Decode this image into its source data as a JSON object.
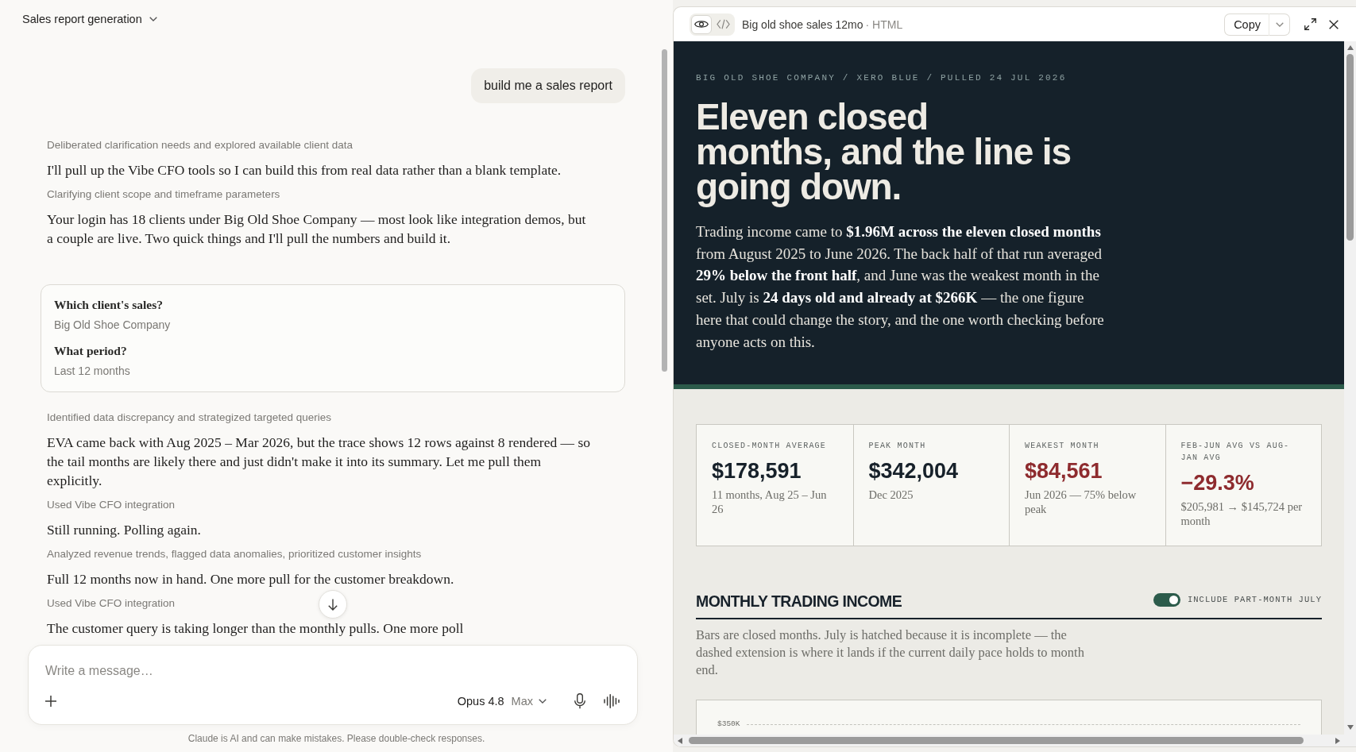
{
  "conversation": {
    "title": "Sales report generation",
    "messages": [
      {
        "kind": "user",
        "text": "build me a sales report"
      },
      {
        "kind": "status",
        "text": "Deliberated clarification needs and explored available client data"
      },
      {
        "kind": "reply",
        "text": "I'll pull up the Vibe CFO tools so I can build this from real data rather than a blank template."
      },
      {
        "kind": "status",
        "text": "Clarifying client scope and timeframe parameters"
      },
      {
        "kind": "reply",
        "text": "Your login has 18 clients under Big Old Shoe Company — most look like integration demos, but a couple are live. Two quick things and I'll pull the numbers and build it."
      },
      {
        "kind": "answers",
        "items": [
          {
            "question": "Which client's sales?",
            "answer": "Big Old Shoe Company"
          },
          {
            "question": "What period?",
            "answer": "Last 12 months"
          }
        ]
      },
      {
        "kind": "status",
        "text": "Identified data discrepancy and strategized targeted queries"
      },
      {
        "kind": "reply",
        "text": "EVA came back with Aug 2025 – Mar 2026, but the trace shows 12 rows against 8 rendered — so the tail months are likely there and just didn't make it into its summary. Let me pull them explicitly."
      },
      {
        "kind": "status",
        "text": "Used Vibe CFO integration"
      },
      {
        "kind": "reply",
        "text": "Still running. Polling again."
      },
      {
        "kind": "status",
        "text": "Analyzed revenue trends, flagged data anomalies, prioritized customer insights"
      },
      {
        "kind": "reply",
        "text": "Full 12 months now in hand. One more pull for the customer breakdown."
      },
      {
        "kind": "status",
        "text": "Used Vibe CFO integration"
      },
      {
        "kind": "reply",
        "text": "The customer query is taking longer than the monthly pulls. One more poll"
      }
    ]
  },
  "composer": {
    "placeholder": "Write a message…",
    "model": "Opus 4.8",
    "effort": "Max"
  },
  "disclaimer": "Claude is AI and can make mistakes. Please double-check responses.",
  "artifact": {
    "view_toggle": [
      {
        "kind": "preview",
        "selected": true
      },
      {
        "kind": "code",
        "selected": false
      }
    ],
    "title": "Big old shoe sales 12mo",
    "format_label": "· HTML",
    "copy_label": "Copy",
    "report": {
      "kicker": "BIG OLD SHOE COMPANY / XERO BLUE / PULLED 24 JUL 2026",
      "headline_lines": [
        "Eleven closed",
        "months, and the line is",
        "going down."
      ],
      "summary": "Trading income came to **$1.96M across the eleven closed months** from August 2025 to June 2026. The back half of that run averaged **29% below the front half**, and June was the weakest month in the set. July is **24 days old and already at $266K** — the one figure here that could change the story, and the one worth checking before anyone acts on this.",
      "kpis": [
        {
          "label": "CLOSED-MONTH AVERAGE",
          "value": "$178,591",
          "note": "11 months, Aug 25 – Jun 26",
          "color": "#17212a"
        },
        {
          "label": "PEAK MONTH",
          "value": "$342,004",
          "note": "Dec 2025",
          "color": "#17212a"
        },
        {
          "label": "WEAKEST MONTH",
          "value": "$84,561",
          "note": "Jun 2026 — 75% below peak",
          "color": "#8e2b2e"
        },
        {
          "label": "FEB-JUN AVG VS AUG-JAN AVG",
          "value": "−29.3%",
          "note": "$205,981 → $145,724 per month",
          "color": "#8e2b2e"
        }
      ],
      "section": {
        "title": "MONTHLY TRADING INCOME",
        "toggle": {
          "label": "INCLUDE PART-MONTH JULY",
          "on": true
        },
        "description": "Bars are closed months. July is hatched because it is incomplete — the dashed extension is where it lands if the current daily pace holds to month end.",
        "chart_top_label": "$350K"
      }
    }
  }
}
